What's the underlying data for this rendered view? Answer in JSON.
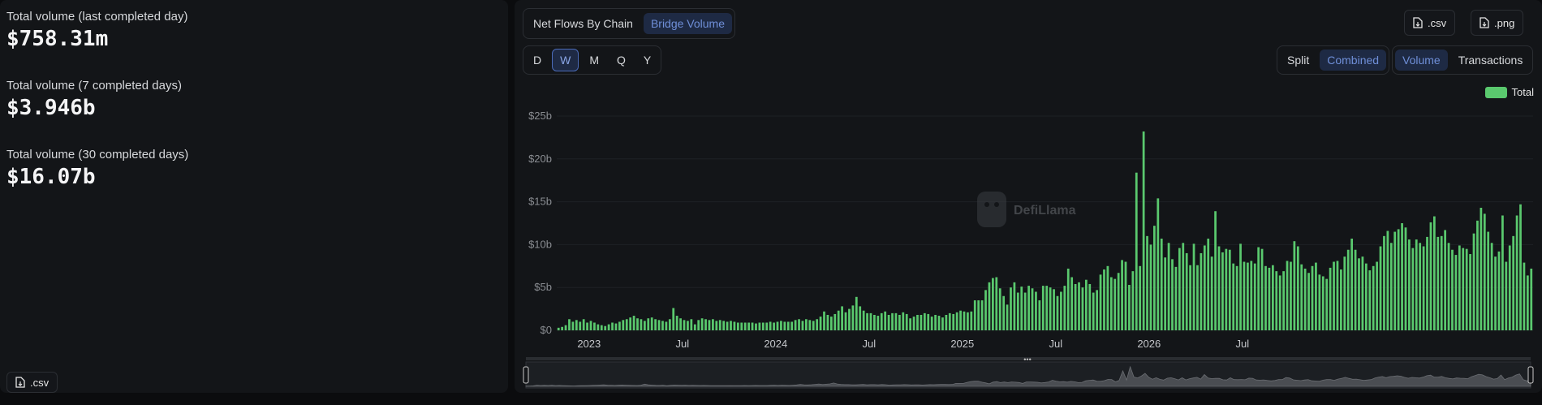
{
  "stats": [
    {
      "label": "Total volume (last completed day)",
      "value": "$758.31m"
    },
    {
      "label": "Total volume (7 completed days)",
      "value": "$3.946b"
    },
    {
      "label": "Total volume (30 completed days)",
      "value": "$16.07b"
    }
  ],
  "left_csv_label": ".csv",
  "tabs": [
    {
      "label": "Net Flows By Chain",
      "active": false
    },
    {
      "label": "Bridge Volume",
      "active": true
    }
  ],
  "periods": [
    {
      "label": "D",
      "active": false
    },
    {
      "label": "W",
      "active": true
    },
    {
      "label": "M",
      "active": false
    },
    {
      "label": "Q",
      "active": false
    },
    {
      "label": "Y",
      "active": false
    }
  ],
  "view_mode": [
    {
      "label": "Split",
      "active": false
    },
    {
      "label": "Combined",
      "active": true
    }
  ],
  "metric": [
    {
      "label": "Volume",
      "active": true
    },
    {
      "label": "Transactions",
      "active": false
    }
  ],
  "export": {
    "csv": ".csv",
    "png": ".png"
  },
  "watermark": "DefiLlama",
  "colors": {
    "bar": "#5ac96e",
    "active_text": "#6f8fd8",
    "active_bg": "#1e2a44"
  },
  "chart_data": {
    "type": "bar",
    "series": [
      {
        "name": "Total",
        "values": [
          0.3,
          0.4,
          0.6,
          1.3,
          1.0,
          1.2,
          1.0,
          1.3,
          0.9,
          1.1,
          0.9,
          0.7,
          0.6,
          0.5,
          0.7,
          0.9,
          0.8,
          1.0,
          1.2,
          1.3,
          1.5,
          1.7,
          1.4,
          1.3,
          1.1,
          1.4,
          1.5,
          1.3,
          1.2,
          1.1,
          1.0,
          1.3,
          2.6,
          1.7,
          1.4,
          1.2,
          1.1,
          1.3,
          0.7,
          1.2,
          1.4,
          1.3,
          1.2,
          1.3,
          1.1,
          1.2,
          1.1,
          1.0,
          1.1,
          1.0,
          0.9,
          0.9,
          0.9,
          0.9,
          0.9,
          0.8,
          0.9,
          0.9,
          0.9,
          1.0,
          0.9,
          1.0,
          1.1,
          1.0,
          1.0,
          1.0,
          1.2,
          1.3,
          1.1,
          1.3,
          1.2,
          1.1,
          1.3,
          1.6,
          2.2,
          1.8,
          1.6,
          1.9,
          2.3,
          2.8,
          2.1,
          2.5,
          2.9,
          3.9,
          2.8,
          2.3,
          2.0,
          2.0,
          1.8,
          1.7,
          2.0,
          2.2,
          1.8,
          2.0,
          2.0,
          1.8,
          2.1,
          1.9,
          1.4,
          1.6,
          1.8,
          1.8,
          2.0,
          1.9,
          1.6,
          1.8,
          1.7,
          1.5,
          1.8,
          2.0,
          1.9,
          2.1,
          2.3,
          2.2,
          2.1,
          2.2,
          3.5,
          3.5,
          3.5,
          4.7,
          5.6,
          6.1,
          6.2,
          4.9,
          4.0,
          3.0,
          5.0,
          5.6,
          4.4,
          5.1,
          4.4,
          5.2,
          4.9,
          4.5,
          3.5,
          5.2,
          5.2,
          5.0,
          4.8,
          4.0,
          4.5,
          5.2,
          7.2,
          6.2,
          5.4,
          5.6,
          5.0,
          5.9,
          5.4,
          4.4,
          4.7,
          6.5,
          7.1,
          7.5,
          6.2,
          6.0,
          6.7,
          8.2,
          8.0,
          5.3,
          6.9,
          18.4,
          7.5,
          23.2,
          11.0,
          10.0,
          12.2,
          15.4,
          10.7,
          8.5,
          10.2,
          8.3,
          7.4,
          9.6,
          10.2,
          9.0,
          7.6,
          10.1,
          7.6,
          9.0,
          9.9,
          10.7,
          8.6,
          13.9,
          9.8,
          9.1,
          9.5,
          9.4,
          7.8,
          7.5,
          10.1,
          8.0,
          7.9,
          8.1,
          7.8,
          9.7,
          9.5,
          7.5,
          7.3,
          7.6,
          6.9,
          6.4,
          6.9,
          8.1,
          8.0,
          10.4,
          9.8,
          7.7,
          7.2,
          6.7,
          7.5,
          7.9,
          6.5,
          6.3,
          6.0,
          7.3,
          8.0,
          8.1,
          7.1,
          8.6,
          9.4,
          10.7,
          9.4,
          8.4,
          8.6,
          7.8,
          7.0,
          7.5,
          8.0,
          9.8,
          11.0,
          11.6,
          10.2,
          11.5,
          11.8,
          12.5,
          12.0,
          10.6,
          9.6,
          10.6,
          10.2,
          9.8,
          10.9,
          12.6,
          13.3,
          10.9,
          11.0,
          11.7,
          10.2,
          9.4,
          8.8,
          9.9,
          9.6,
          9.5,
          8.9,
          11.3,
          12.8,
          14.3,
          13.6,
          11.5,
          10.2,
          8.6,
          9.2,
          13.4,
          8.0,
          9.9,
          11.0,
          13.4,
          14.7,
          7.9,
          6.4,
          7.2
        ]
      }
    ],
    "x_ticks": [
      "2023",
      "Jul",
      "2024",
      "Jul",
      "2025",
      "Jul",
      "2026",
      "Jul"
    ],
    "y_ticks": [
      "$0",
      "$5b",
      "$10b",
      "$15b",
      "$20b",
      "$25b"
    ],
    "ylim": [
      0,
      25
    ],
    "y_unit": "billion USD",
    "legend": "top-right"
  }
}
